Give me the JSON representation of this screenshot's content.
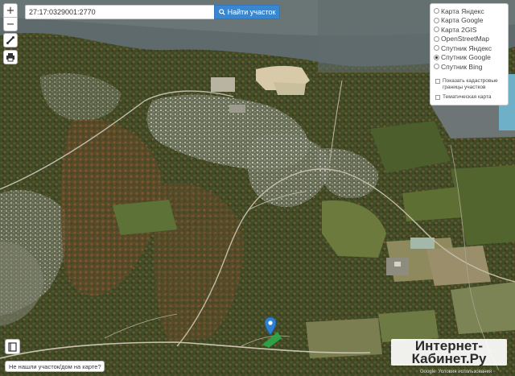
{
  "search": {
    "value": "27:17:0329001:2770",
    "button_label": "Найти участок"
  },
  "controls": {
    "zoom_in": "+",
    "zoom_out": "−"
  },
  "layers": {
    "options": [
      {
        "label": "Карта Яндекс",
        "selected": false
      },
      {
        "label": "Карта Google",
        "selected": false
      },
      {
        "label": "Карта 2GIS",
        "selected": false
      },
      {
        "label": "OpenStreetMap",
        "selected": false
      },
      {
        "label": "Спутник Яндекс",
        "selected": false
      },
      {
        "label": "Спутник Google",
        "selected": true
      },
      {
        "label": "Спутник Bing",
        "selected": false
      }
    ],
    "cadastral": "Показать кадастровые границы участков",
    "thematic": "Тематическая карта"
  },
  "not_found": "Не нашли участок/дом на карте?",
  "watermark": {
    "line1": "Интернет-",
    "line2": "Кабинет.Ру"
  },
  "attribution": {
    "provider": "Google",
    "text": "Условия использования"
  },
  "colors": {
    "button_blue": "#3a87d0",
    "marker_blue": "#2f80d0",
    "parcel_green": "#2ea84a"
  }
}
